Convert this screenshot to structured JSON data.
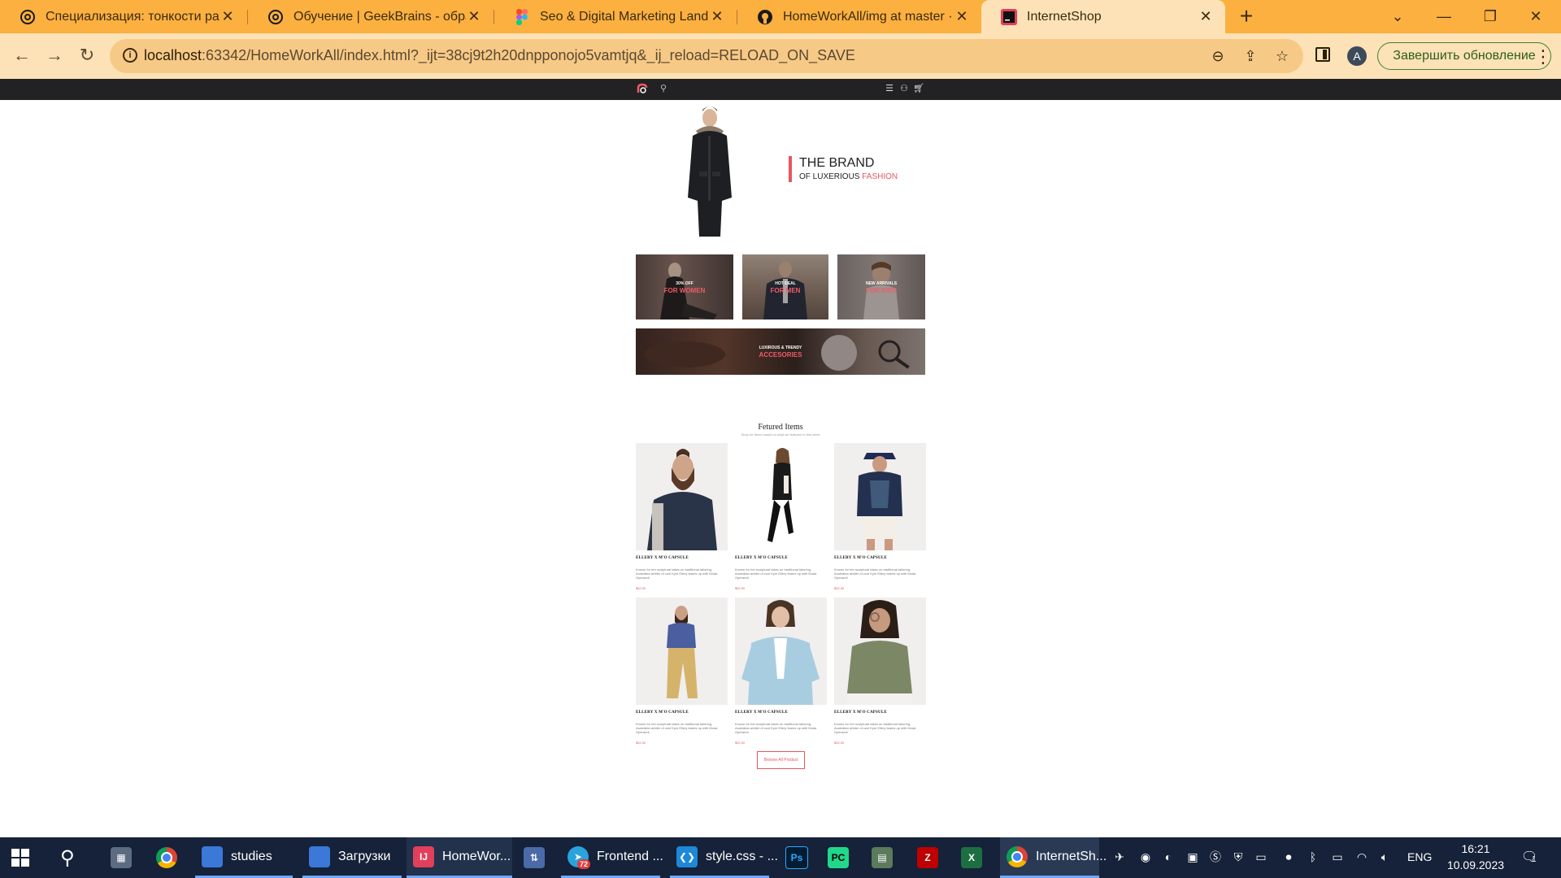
{
  "browser": {
    "tabs": [
      {
        "title": "Специализация: тонкости работ",
        "active": false
      },
      {
        "title": "Обучение | GeekBrains - образо",
        "active": false
      },
      {
        "title": "Seo & Digital Marketing Landing",
        "active": false
      },
      {
        "title": "HomeWorkAll/img at master · Ge",
        "active": false
      },
      {
        "title": "InternetShop",
        "active": true
      }
    ],
    "url_host": "localhost",
    "url_rest": ":63342/HomeWorkAll/index.html?_ijt=38cj9t2h20dnpponojo5vamtjq&_ij_reload=RELOAD_ON_SAVE",
    "profile_initial": "A",
    "update_button": "Завершить обновление",
    "chrome_color": "#fcb040"
  },
  "site": {
    "hero": {
      "title": "THE BRAND",
      "subtitle_prefix": "OF LUXERIOUS ",
      "subtitle_accent": "FASHION"
    },
    "promos": [
      {
        "tag": "30% OFF",
        "label": "FOR WOMEN"
      },
      {
        "tag": "HOT DEAL",
        "label": "FOR MEN"
      },
      {
        "tag": "NEW ARRIVALS",
        "label": "FOR KIDS"
      },
      {
        "tag": "LUXIROUS & TRENDY",
        "label": "ACCESORIES"
      }
    ],
    "featured": {
      "title": "Fetured Items",
      "subtitle": "Shop for items based on what we featured in this week"
    },
    "products": [
      {
        "name": "ELLERY X M'O CAPSULE",
        "desc": "Known for her sculptural takes on traditional tailoring, Australian arbiter of cool Kym Ellery teams up with Moda Operandi.",
        "price": "$52.00"
      },
      {
        "name": "ELLERY X M'O CAPSULE",
        "desc": "Known for her sculptural takes on traditional tailoring, Australian arbiter of cool Kym Ellery teams up with Moda Operandi.",
        "price": "$52.00"
      },
      {
        "name": "ELLERY X M'O CAPSULE",
        "desc": "Known for her sculptural takes on traditional tailoring, Australian arbiter of cool Kym Ellery teams up with Moda Operandi.",
        "price": "$52.00"
      },
      {
        "name": "ELLERY X M'O CAPSULE",
        "desc": "Known for her sculptural takes on traditional tailoring, Australian arbiter of cool Kym Ellery teams up with Moda Operandi.",
        "price": "$52.00"
      },
      {
        "name": "ELLERY X M'O CAPSULE",
        "desc": "Known for her sculptural takes on traditional tailoring, Australian arbiter of cool Kym Ellery teams up with Moda Operandi.",
        "price": "$52.00"
      },
      {
        "name": "ELLERY X M'O CAPSULE",
        "desc": "Known for her sculptural takes on traditional tailoring, Australian arbiter of cool Kym Ellery teams up with Moda Operandi.",
        "price": "$52.00"
      }
    ],
    "browse_button": "Browse All Product",
    "accent_color": "#e8565f"
  },
  "taskbar": {
    "apps": [
      {
        "label": "studies"
      },
      {
        "label": "Загрузки"
      },
      {
        "label": "HomeWor..."
      },
      {
        "label": "Frontend ..."
      },
      {
        "label": "style.css - ..."
      },
      {
        "label": "InternetSh..."
      }
    ],
    "telegram_badge": "72",
    "language": "ENG",
    "time": "16:21",
    "date": "10.09.2023",
    "notifications": "1"
  }
}
